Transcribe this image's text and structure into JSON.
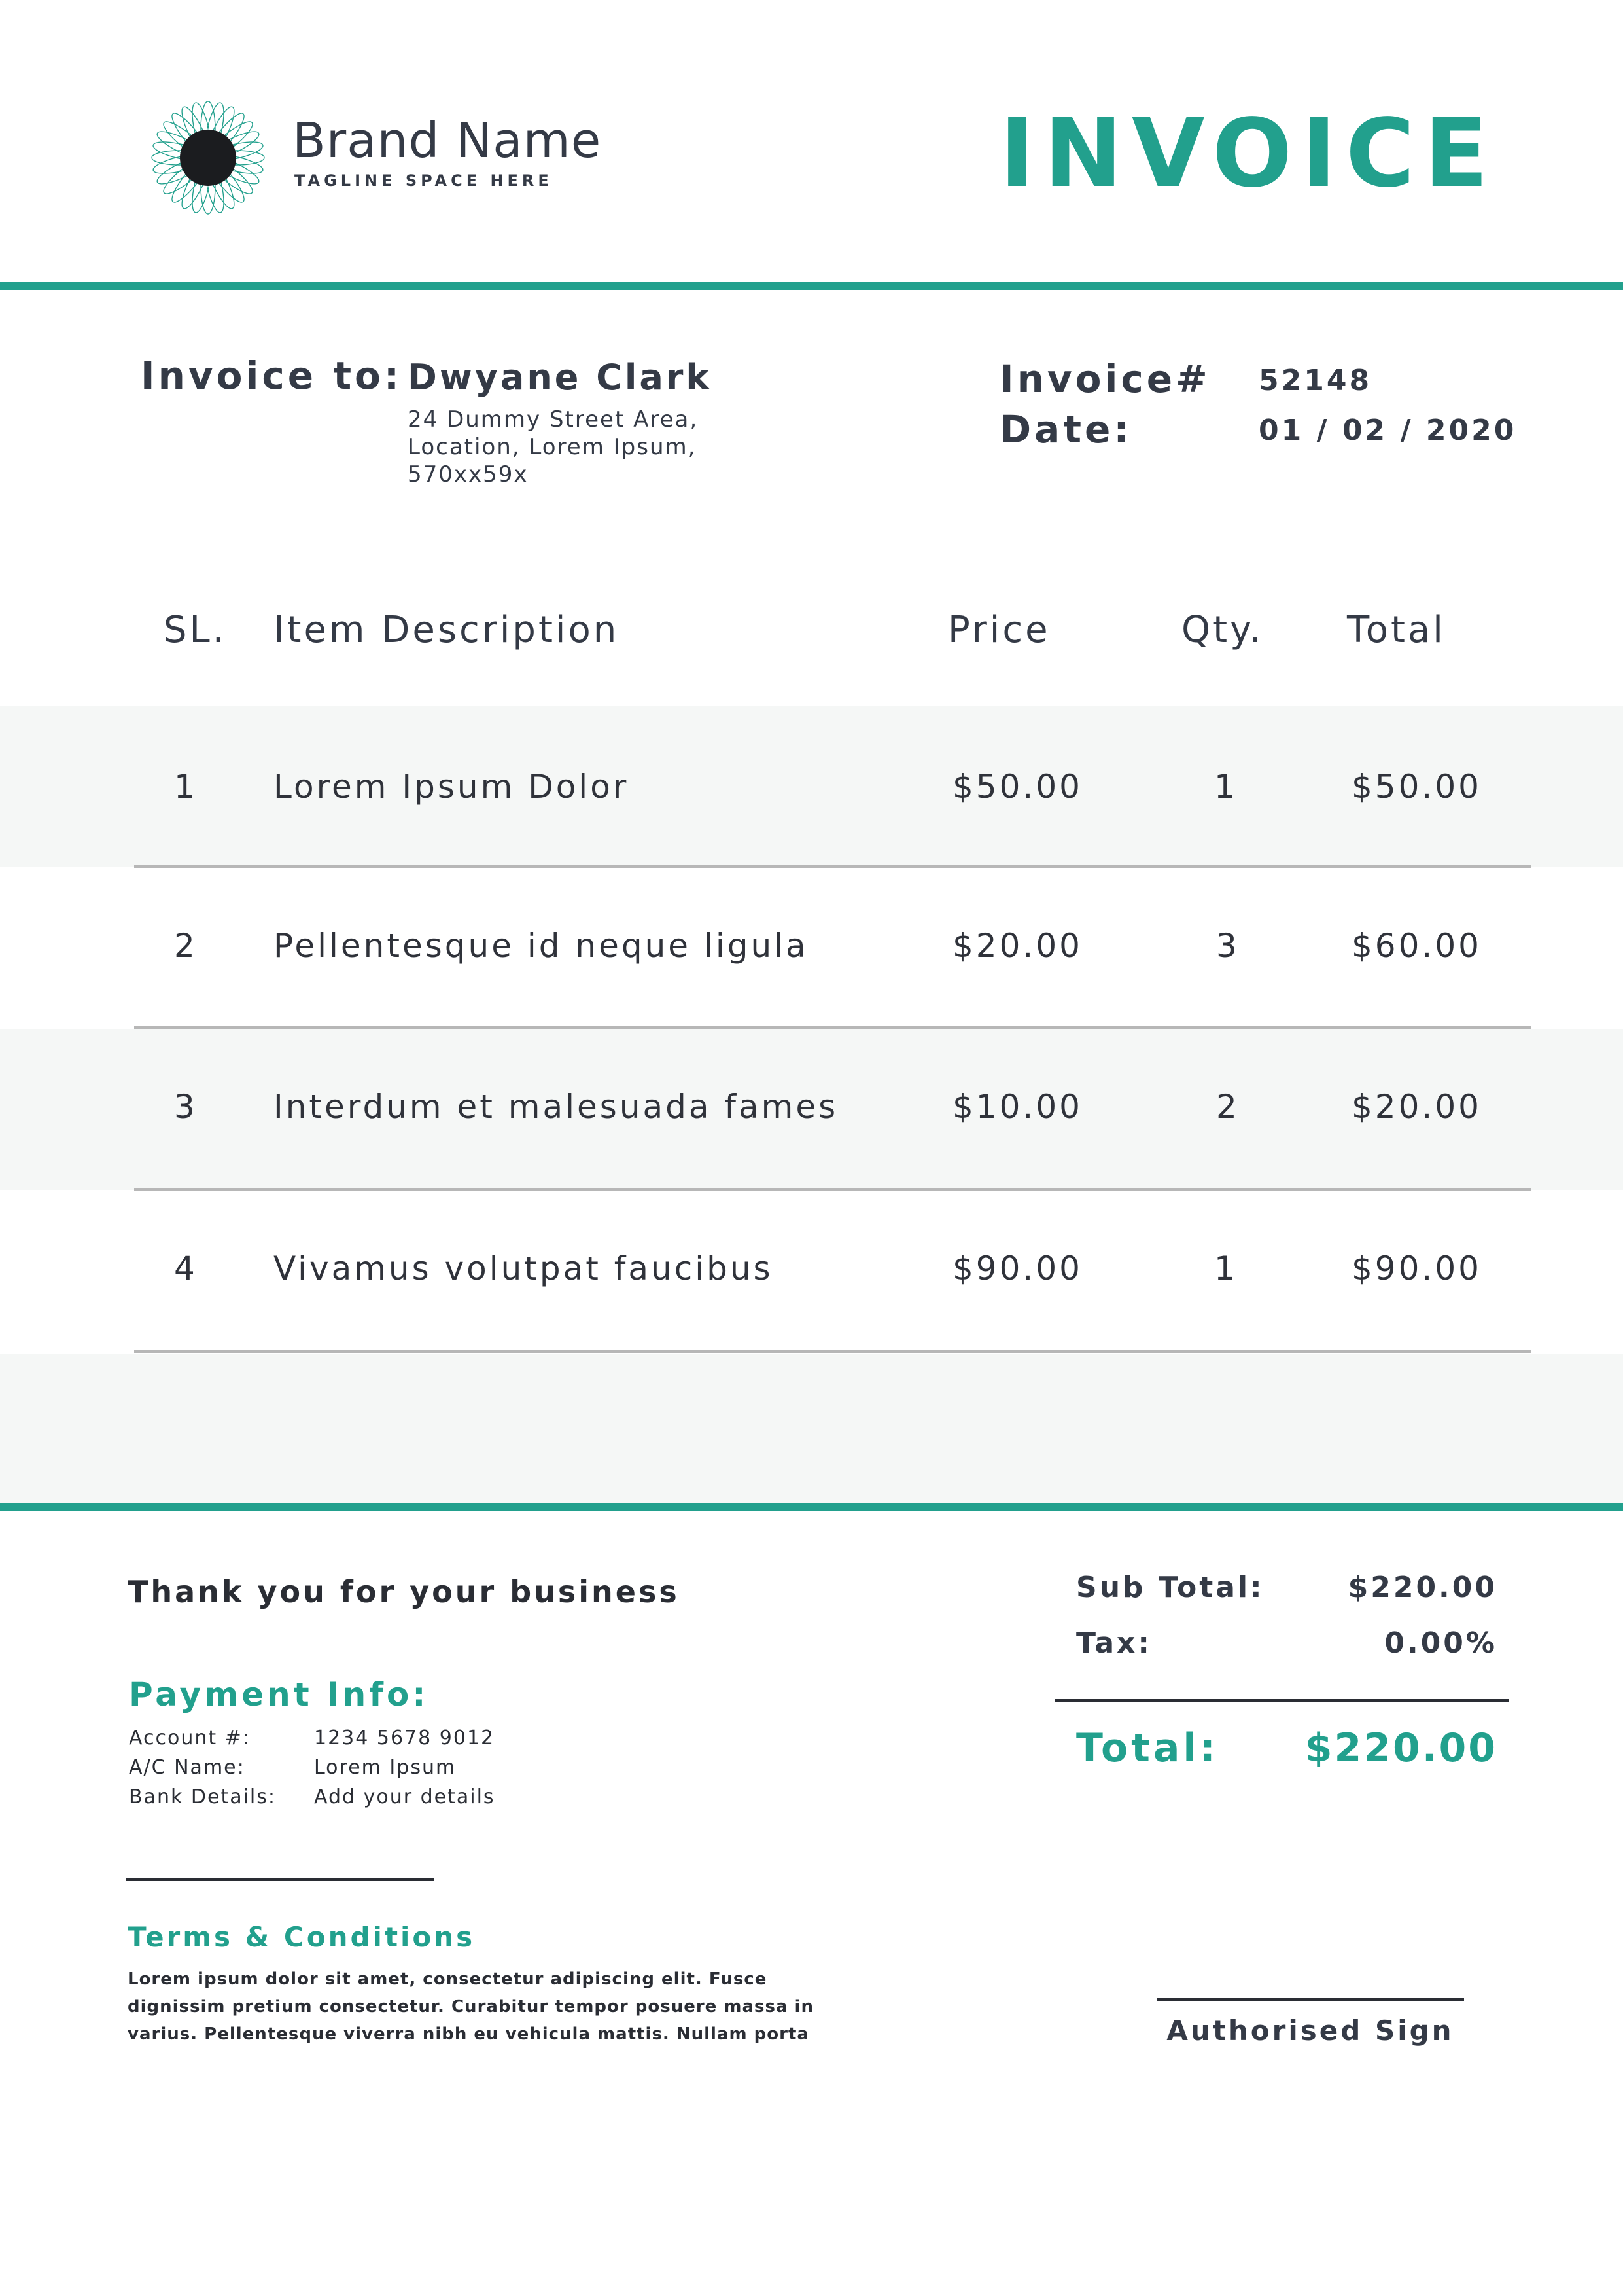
{
  "brand": {
    "name": "Brand Name",
    "tagline": "TAGLINE SPACE HERE",
    "logo_icon": "spirograph-logo-icon"
  },
  "document_title": "INVOICE",
  "bill_to": {
    "label": "Invoice to:",
    "name": "Dwyane Clark",
    "address_lines": [
      "24 Dummy Street Area,",
      "Location, Lorem Ipsum,",
      "570xx59x"
    ]
  },
  "meta": {
    "invoice_label": "Invoice#",
    "invoice_number": "52148",
    "date_label": "Date:",
    "date_value": "01 / 02 / 2020"
  },
  "table": {
    "headers": [
      "SL.",
      "Item Description",
      "Price",
      "Qty.",
      "Total"
    ],
    "rows": [
      {
        "sl": "1",
        "description": "Lorem Ipsum Dolor",
        "price": "$50.00",
        "qty": "1",
        "total": "$50.00"
      },
      {
        "sl": "2",
        "description": "Pellentesque id neque ligula",
        "price": "$20.00",
        "qty": "3",
        "total": "$60.00"
      },
      {
        "sl": "3",
        "description": "Interdum et malesuada fames",
        "price": "$10.00",
        "qty": "2",
        "total": "$20.00"
      },
      {
        "sl": "4",
        "description": "Vivamus volutpat faucibus",
        "price": "$90.00",
        "qty": "1",
        "total": "$90.00"
      }
    ]
  },
  "thanks": "Thank you for your business",
  "payment": {
    "heading": "Payment Info:",
    "account_label": "Account #:",
    "account_value": "1234 5678 9012",
    "ac_name_label": "A/C Name:",
    "ac_name_value": "Lorem Ipsum",
    "bank_label": "Bank Details:",
    "bank_value": "Add your details"
  },
  "terms": {
    "heading": "Terms & Conditions",
    "line1": "Lorem ipsum dolor sit amet, consectetur adipiscing elit. Fusce",
    "line2": "dignissim pretium consectetur. Curabitur tempor posuere massa in",
    "line3": "varius. Pellentesque viverra nibh eu vehicula mattis. Nullam porta"
  },
  "totals": {
    "subtotal_label": "Sub Total:",
    "subtotal_value": "$220.00",
    "tax_label": "Tax:",
    "tax_value": "0.00%",
    "total_label": "Total:",
    "total_value": "$220.00"
  },
  "signature": {
    "label": "Authorised Sign"
  },
  "colors": {
    "accent": "#22a08d",
    "text": "#2f323a",
    "row_shade": "#f5f7f6"
  }
}
